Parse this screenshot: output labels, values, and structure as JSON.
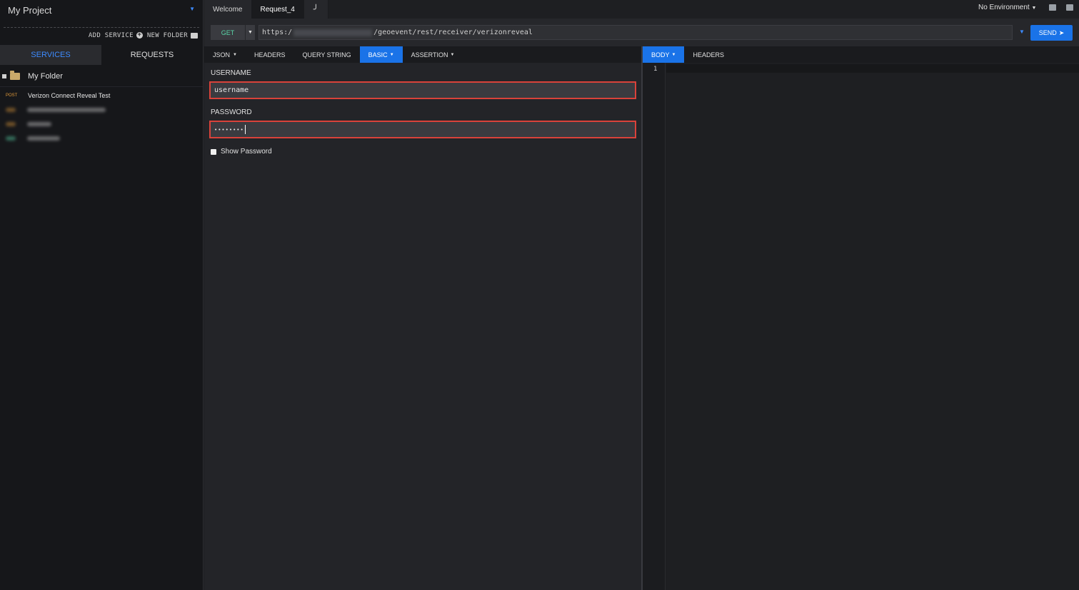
{
  "sidebar": {
    "project_name": "My Project",
    "add_service": "ADD SERVICE",
    "new_folder": "NEW FOLDER",
    "tabs": [
      {
        "label": "SERVICES"
      },
      {
        "label": "REQUESTS"
      }
    ],
    "folder": {
      "name": "My Folder"
    },
    "items": [
      {
        "method": "POST",
        "name": "Verizon Connect Reveal Test"
      }
    ]
  },
  "tabs": [
    {
      "label": "Welcome"
    },
    {
      "label": "Request_4"
    }
  ],
  "environment": {
    "label": "No Environment"
  },
  "request": {
    "method": "GET",
    "url_prefix": "https:/",
    "url_suffix": "/geoevent/rest/receiver/verizonreveal",
    "send_label": "SEND"
  },
  "request_tabs": [
    {
      "label": "JSON"
    },
    {
      "label": "HEADERS"
    },
    {
      "label": "QUERY STRING"
    },
    {
      "label": "BASIC"
    },
    {
      "label": "ASSERTION"
    }
  ],
  "auth": {
    "username_label": "USERNAME",
    "username_value": "username",
    "password_label": "PASSWORD",
    "password_value": "••••••••",
    "show_password_label": "Show Password"
  },
  "response_tabs": [
    {
      "label": "BODY"
    },
    {
      "label": "HEADERS"
    }
  ],
  "editor": {
    "line_number": "1"
  },
  "colors": {
    "accent": "#1a73e8",
    "highlight_border": "#d9423a",
    "post_method": "#e09a3a",
    "get_method": "#5ad6a8"
  }
}
